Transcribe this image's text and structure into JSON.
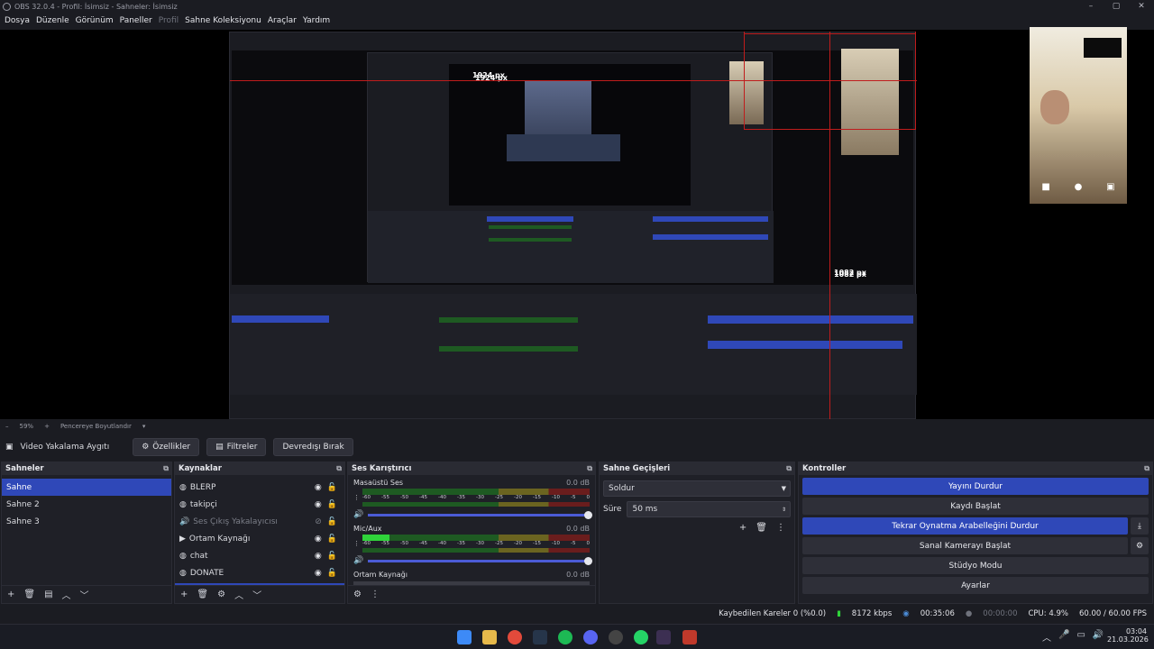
{
  "window": {
    "title": "OBS 32.0.4 - Profil: İsimsiz - Sahneler: İsimsiz"
  },
  "menu": [
    "Dosya",
    "Düzenle",
    "Görünüm",
    "Paneller",
    "Profil",
    "Sahne Koleksiyonu",
    "Araçlar",
    "Yardım"
  ],
  "preview": {
    "label_w": "1924 px",
    "label_h": "1082 px",
    "inner_label_w": "1924 px",
    "inner_label_h": "1082 px"
  },
  "zoom": {
    "percent": "59%",
    "mode": "Pencereye Boyutlandır"
  },
  "source_toolbar": {
    "source_name": "Video Yakalama Aygıtı",
    "properties": "Özellikler",
    "filters": "Filtreler",
    "deactivate": "Devredışı Bırak"
  },
  "scenes": {
    "title": "Sahneler",
    "items": [
      "Sahne",
      "Sahne 2",
      "Sahne 3"
    ],
    "selected": 0
  },
  "sources": {
    "title": "Kaynaklar",
    "items": [
      {
        "name": "BLERP",
        "icon": "globe-icon"
      },
      {
        "name": "takipçi",
        "icon": "globe-icon"
      },
      {
        "name": "Ses Çıkış Yakalayıcısı",
        "icon": "speaker-icon",
        "hidden": true
      },
      {
        "name": "Ortam Kaynağı",
        "icon": "play-icon"
      },
      {
        "name": "chat",
        "icon": "globe-icon"
      },
      {
        "name": "DONATE",
        "icon": "globe-icon"
      }
    ]
  },
  "mixer": {
    "title": "Ses Karıştırıcı",
    "channels": [
      {
        "name": "Masaüstü Ses",
        "db": "0.0 dB",
        "level": 0.0
      },
      {
        "name": "Mic/Aux",
        "db": "0.0 dB",
        "level": 0.12
      },
      {
        "name": "Ortam Kaynağı",
        "db": "0.0 dB",
        "level": 0.0
      }
    ],
    "ticks": [
      "-60",
      "-55",
      "-50",
      "-45",
      "-40",
      "-35",
      "-30",
      "-25",
      "-20",
      "-15",
      "-10",
      "-5",
      "0"
    ]
  },
  "transitions": {
    "title": "Sahne Geçişleri",
    "selected": "Soldur",
    "duration_label": "Süre",
    "duration_value": "50 ms"
  },
  "controls": {
    "title": "Kontroller",
    "buttons": [
      {
        "label": "Yayını Durdur",
        "active": true
      },
      {
        "label": "Kaydı Başlat",
        "active": false
      },
      {
        "label": "Tekrar Oynatma Arabelleğini Durdur",
        "active": true
      },
      {
        "label": "Sanal Kamerayı Başlat",
        "active": false
      },
      {
        "label": "Stüdyo Modu",
        "active": false
      },
      {
        "label": "Ayarlar",
        "active": false
      }
    ]
  },
  "status": {
    "dropped": "Kaybedilen Kareler 0 (%0.0)",
    "bitrate": "8172 kbps",
    "stream_time": "00:35:06",
    "rec_time": "00:00:00",
    "cpu": "CPU: 4.9%",
    "fps": "60.00 / 60.00 FPS"
  },
  "taskbar": {
    "time": "03:04",
    "date": "21.03.2026"
  },
  "colors": {
    "accent": "#2f48b8",
    "bg": "#1b1c22",
    "panel": "#1f2027",
    "red_guide": "#c01c1c"
  }
}
